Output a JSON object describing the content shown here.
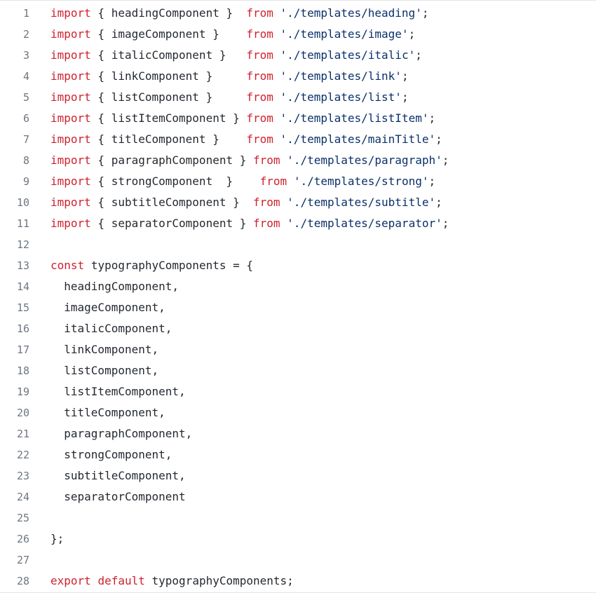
{
  "code": {
    "lines": [
      {
        "number": "1",
        "tokens": [
          [
            "kw",
            "import"
          ],
          [
            "punc",
            " { "
          ],
          [
            "id",
            "headingComponent"
          ],
          [
            "punc",
            " }  "
          ],
          [
            "kw",
            "from"
          ],
          [
            "punc",
            " "
          ],
          [
            "str",
            "'./templates/heading'"
          ],
          [
            "punc",
            ";"
          ]
        ]
      },
      {
        "number": "2",
        "tokens": [
          [
            "kw",
            "import"
          ],
          [
            "punc",
            " { "
          ],
          [
            "id",
            "imageComponent"
          ],
          [
            "punc",
            " }    "
          ],
          [
            "kw",
            "from"
          ],
          [
            "punc",
            " "
          ],
          [
            "str",
            "'./templates/image'"
          ],
          [
            "punc",
            ";"
          ]
        ]
      },
      {
        "number": "3",
        "tokens": [
          [
            "kw",
            "import"
          ],
          [
            "punc",
            " { "
          ],
          [
            "id",
            "italicComponent"
          ],
          [
            "punc",
            " }   "
          ],
          [
            "kw",
            "from"
          ],
          [
            "punc",
            " "
          ],
          [
            "str",
            "'./templates/italic'"
          ],
          [
            "punc",
            ";"
          ]
        ]
      },
      {
        "number": "4",
        "tokens": [
          [
            "kw",
            "import"
          ],
          [
            "punc",
            " { "
          ],
          [
            "id",
            "linkComponent"
          ],
          [
            "punc",
            " }     "
          ],
          [
            "kw",
            "from"
          ],
          [
            "punc",
            " "
          ],
          [
            "str",
            "'./templates/link'"
          ],
          [
            "punc",
            ";"
          ]
        ]
      },
      {
        "number": "5",
        "tokens": [
          [
            "kw",
            "import"
          ],
          [
            "punc",
            " { "
          ],
          [
            "id",
            "listComponent"
          ],
          [
            "punc",
            " }     "
          ],
          [
            "kw",
            "from"
          ],
          [
            "punc",
            " "
          ],
          [
            "str",
            "'./templates/list'"
          ],
          [
            "punc",
            ";"
          ]
        ]
      },
      {
        "number": "6",
        "tokens": [
          [
            "kw",
            "import"
          ],
          [
            "punc",
            " { "
          ],
          [
            "id",
            "listItemComponent"
          ],
          [
            "punc",
            " } "
          ],
          [
            "kw",
            "from"
          ],
          [
            "punc",
            " "
          ],
          [
            "str",
            "'./templates/listItem'"
          ],
          [
            "punc",
            ";"
          ]
        ]
      },
      {
        "number": "7",
        "tokens": [
          [
            "kw",
            "import"
          ],
          [
            "punc",
            " { "
          ],
          [
            "id",
            "titleComponent"
          ],
          [
            "punc",
            " }    "
          ],
          [
            "kw",
            "from"
          ],
          [
            "punc",
            " "
          ],
          [
            "str",
            "'./templates/mainTitle'"
          ],
          [
            "punc",
            ";"
          ]
        ]
      },
      {
        "number": "8",
        "tokens": [
          [
            "kw",
            "import"
          ],
          [
            "punc",
            " { "
          ],
          [
            "id",
            "paragraphComponent"
          ],
          [
            "punc",
            " } "
          ],
          [
            "kw",
            "from"
          ],
          [
            "punc",
            " "
          ],
          [
            "str",
            "'./templates/paragraph'"
          ],
          [
            "punc",
            ";"
          ]
        ]
      },
      {
        "number": "9",
        "tokens": [
          [
            "kw",
            "import"
          ],
          [
            "punc",
            " { "
          ],
          [
            "id",
            "strongComponent"
          ],
          [
            "punc",
            "  }    "
          ],
          [
            "kw",
            "from"
          ],
          [
            "punc",
            " "
          ],
          [
            "str",
            "'./templates/strong'"
          ],
          [
            "punc",
            ";"
          ]
        ]
      },
      {
        "number": "10",
        "tokens": [
          [
            "kw",
            "import"
          ],
          [
            "punc",
            " { "
          ],
          [
            "id",
            "subtitleComponent"
          ],
          [
            "punc",
            " }  "
          ],
          [
            "kw",
            "from"
          ],
          [
            "punc",
            " "
          ],
          [
            "str",
            "'./templates/subtitle'"
          ],
          [
            "punc",
            ";"
          ]
        ]
      },
      {
        "number": "11",
        "tokens": [
          [
            "kw",
            "import"
          ],
          [
            "punc",
            " { "
          ],
          [
            "id",
            "separatorComponent"
          ],
          [
            "punc",
            " } "
          ],
          [
            "kw",
            "from"
          ],
          [
            "punc",
            " "
          ],
          [
            "str",
            "'./templates/separator'"
          ],
          [
            "punc",
            ";"
          ]
        ]
      },
      {
        "number": "12",
        "tokens": []
      },
      {
        "number": "13",
        "tokens": [
          [
            "kw",
            "const"
          ],
          [
            "punc",
            " "
          ],
          [
            "id",
            "typographyComponents"
          ],
          [
            "punc",
            " = {"
          ]
        ]
      },
      {
        "number": "14",
        "tokens": [
          [
            "punc",
            "  "
          ],
          [
            "id",
            "headingComponent"
          ],
          [
            "punc",
            ","
          ]
        ]
      },
      {
        "number": "15",
        "tokens": [
          [
            "punc",
            "  "
          ],
          [
            "id",
            "imageComponent"
          ],
          [
            "punc",
            ","
          ]
        ]
      },
      {
        "number": "16",
        "tokens": [
          [
            "punc",
            "  "
          ],
          [
            "id",
            "italicComponent"
          ],
          [
            "punc",
            ","
          ]
        ]
      },
      {
        "number": "17",
        "tokens": [
          [
            "punc",
            "  "
          ],
          [
            "id",
            "linkComponent"
          ],
          [
            "punc",
            ","
          ]
        ]
      },
      {
        "number": "18",
        "tokens": [
          [
            "punc",
            "  "
          ],
          [
            "id",
            "listComponent"
          ],
          [
            "punc",
            ","
          ]
        ]
      },
      {
        "number": "19",
        "tokens": [
          [
            "punc",
            "  "
          ],
          [
            "id",
            "listItemComponent"
          ],
          [
            "punc",
            ","
          ]
        ]
      },
      {
        "number": "20",
        "tokens": [
          [
            "punc",
            "  "
          ],
          [
            "id",
            "titleComponent"
          ],
          [
            "punc",
            ","
          ]
        ]
      },
      {
        "number": "21",
        "tokens": [
          [
            "punc",
            "  "
          ],
          [
            "id",
            "paragraphComponent"
          ],
          [
            "punc",
            ","
          ]
        ]
      },
      {
        "number": "22",
        "tokens": [
          [
            "punc",
            "  "
          ],
          [
            "id",
            "strongComponent"
          ],
          [
            "punc",
            ","
          ]
        ]
      },
      {
        "number": "23",
        "tokens": [
          [
            "punc",
            "  "
          ],
          [
            "id",
            "subtitleComponent"
          ],
          [
            "punc",
            ","
          ]
        ]
      },
      {
        "number": "24",
        "tokens": [
          [
            "punc",
            "  "
          ],
          [
            "id",
            "separatorComponent"
          ]
        ]
      },
      {
        "number": "25",
        "tokens": []
      },
      {
        "number": "26",
        "tokens": [
          [
            "punc",
            "};"
          ]
        ]
      },
      {
        "number": "27",
        "tokens": []
      },
      {
        "number": "28",
        "tokens": [
          [
            "kw",
            "export"
          ],
          [
            "punc",
            " "
          ],
          [
            "kw",
            "default"
          ],
          [
            "punc",
            " "
          ],
          [
            "id",
            "typographyComponents"
          ],
          [
            "punc",
            ";"
          ]
        ]
      }
    ]
  },
  "colors": {
    "keyword": "#cf222e",
    "string": "#0a3069",
    "identifier": "#24292f",
    "line_number": "#6e7781",
    "background": "#ffffff"
  }
}
